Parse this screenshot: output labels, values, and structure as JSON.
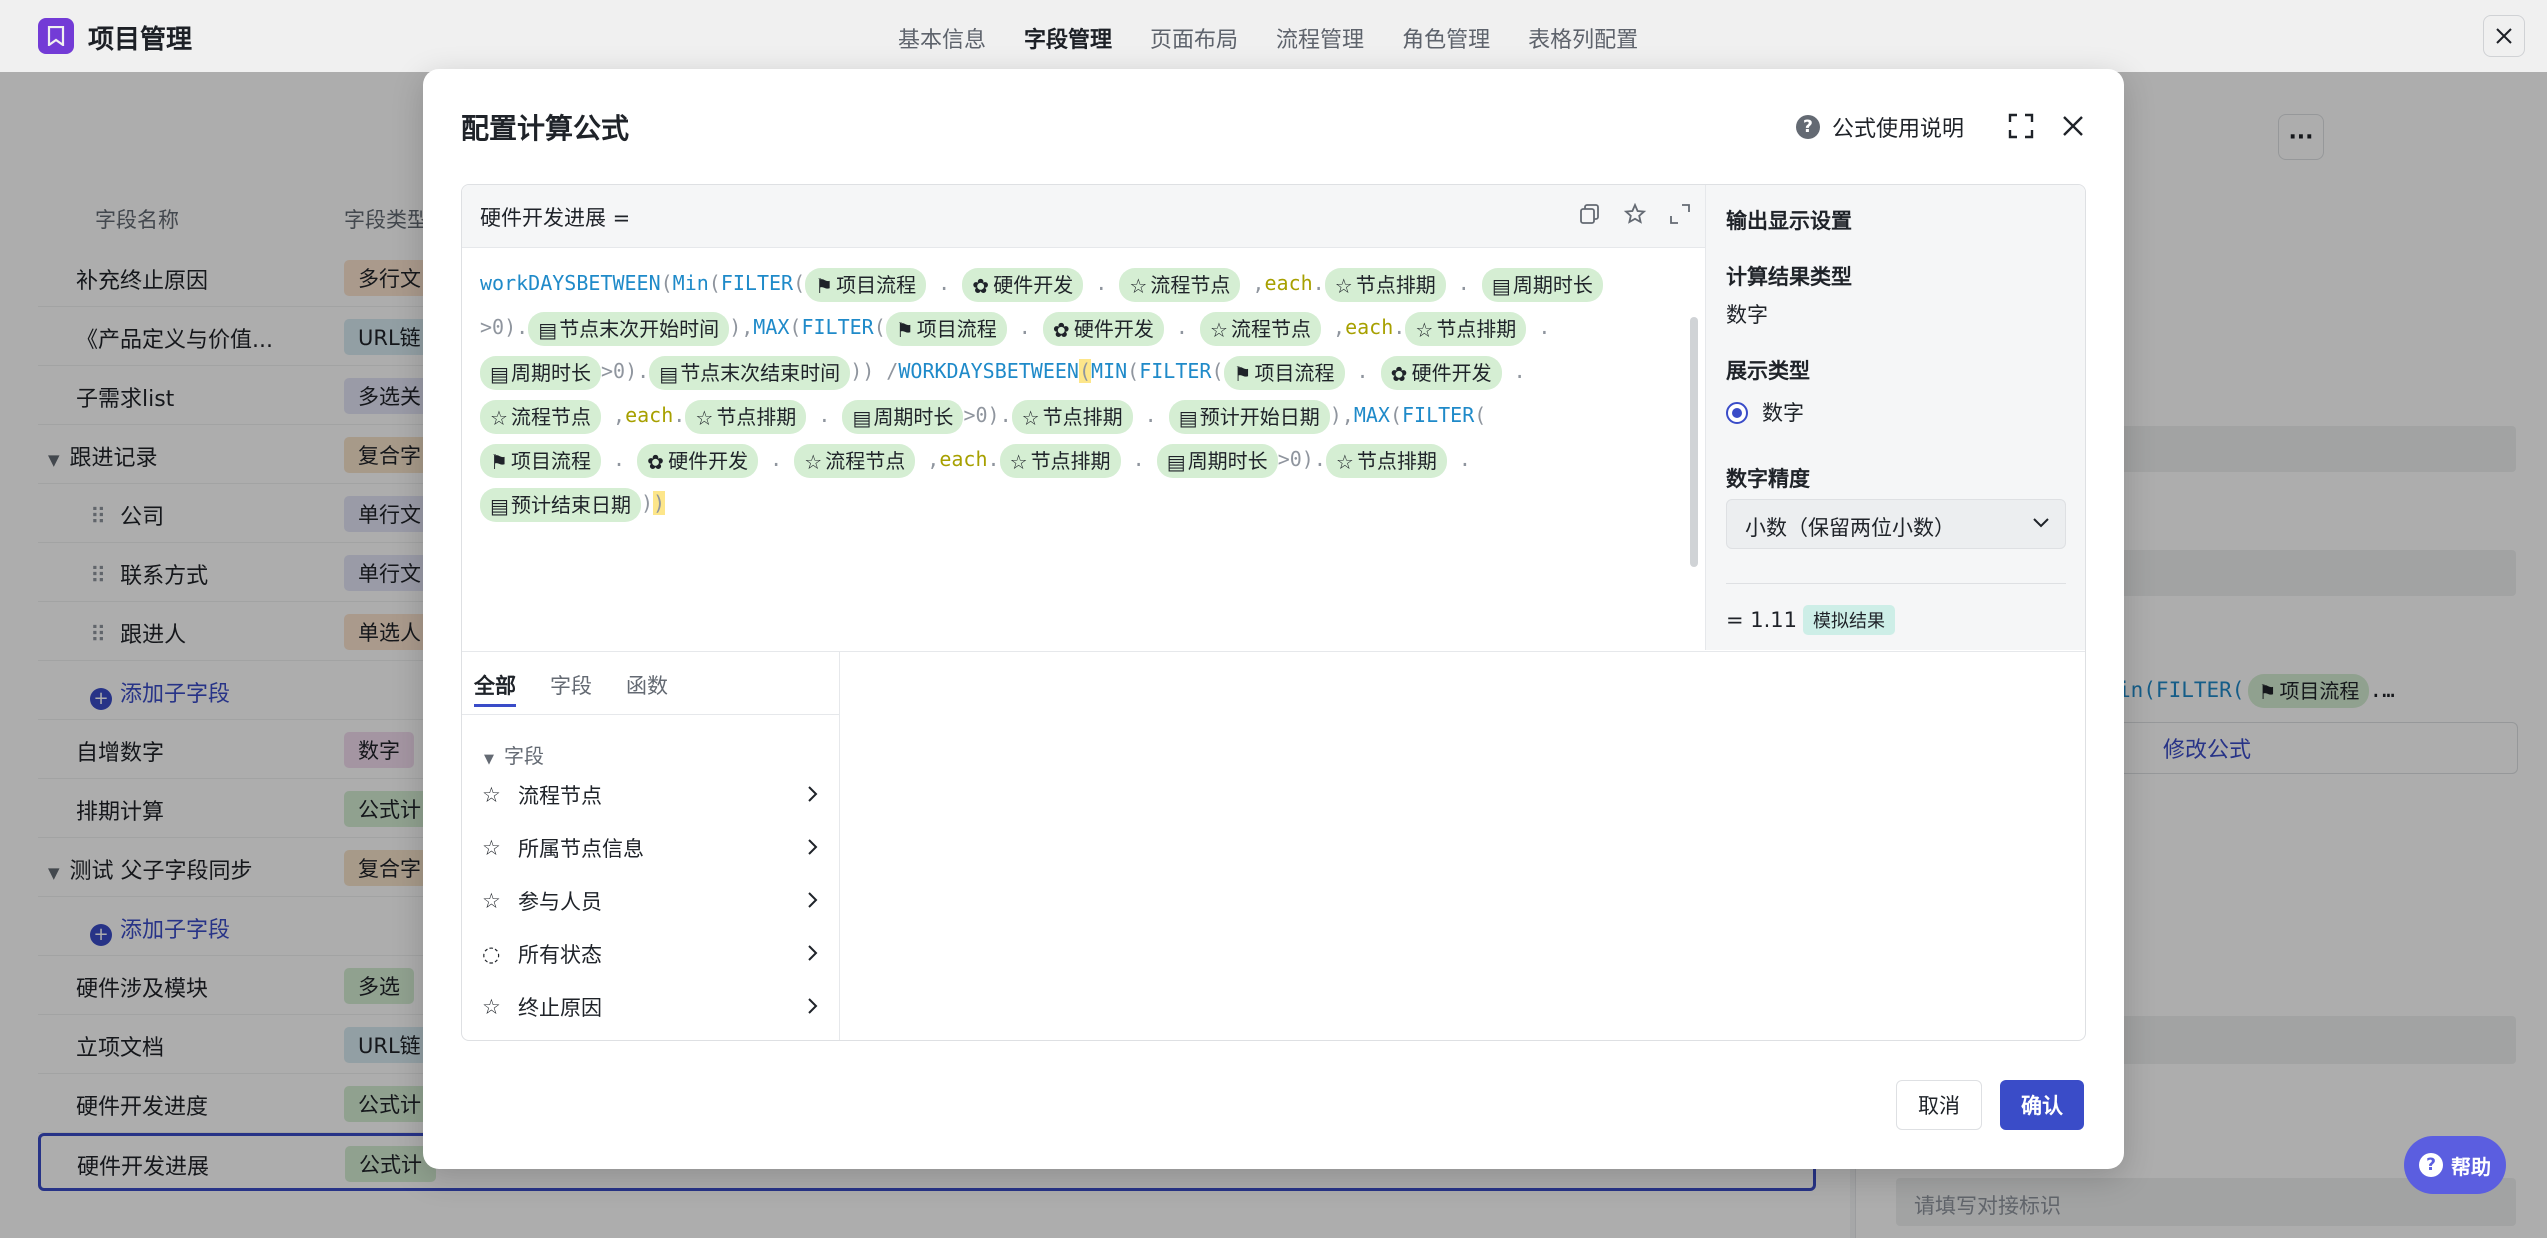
{
  "app": {
    "title": "项目管理",
    "close_icon": "close-icon"
  },
  "nav_tabs": [
    "基本信息",
    "字段管理",
    "页面布局",
    "流程管理",
    "角色管理",
    "表格列配置"
  ],
  "nav_active": "字段管理",
  "columns": {
    "name": "字段名称",
    "type": "字段类型"
  },
  "fields": [
    {
      "name": "补充终止原因",
      "type": "多行文",
      "type_color": "#fbe3cf"
    },
    {
      "name": "《产品定义与价值...",
      "type": "URL链",
      "type_color": "#d7ebf2"
    },
    {
      "name": "子需求list",
      "type": "多选关",
      "type_color": "#e3e5f7"
    },
    {
      "name": "跟进记录",
      "type": "复合字",
      "type_color": "#f7e3cb"
    },
    {
      "name": "公司",
      "type": "单行文",
      "type_color": "#e3e5f7"
    },
    {
      "name": "联系方式",
      "type": "单行文",
      "type_color": "#e3e5f7"
    },
    {
      "name": "跟进人",
      "type": "单选人",
      "type_color": "#fbe3cf"
    },
    {
      "name": "添加子字段",
      "type": "",
      "type_color": ""
    },
    {
      "name": "自增数字",
      "type": "数字",
      "type_color": "#f2dcef"
    },
    {
      "name": "排期计算",
      "type": "公式计",
      "type_color": "#d5eed3"
    },
    {
      "name": "测试 父子字段同步",
      "type": "复合字",
      "type_color": "#f7e3cb"
    },
    {
      "name": "添加子字段",
      "type": "",
      "type_color": ""
    },
    {
      "name": "硬件涉及模块",
      "type": "多选",
      "type_color": "#d5eed3"
    },
    {
      "name": "立项文档",
      "type": "URL链",
      "type_color": "#d7ebf2"
    },
    {
      "name": "硬件开发进度",
      "type": "公式计",
      "type_color": "#d5eed3"
    },
    {
      "name": "硬件开发进展",
      "type": "公式计",
      "type_color": "#d5eed3"
    }
  ],
  "right_panel": {
    "formula_preview": "in(FILTER(",
    "formula_chip": "项目流程",
    "formula_ellipsis": ".…",
    "edit_formula": "修改公式",
    "placeholder": "请填写对接标识"
  },
  "modal": {
    "title": "配置计算公式",
    "help_link": "公式使用说明",
    "editor_lhs": "硬件开发进展 =",
    "output": {
      "header": "输出显示设置",
      "result_type_label": "计算结果类型",
      "result_type_value": "数字",
      "display_type_label": "展示类型",
      "display_type_value": "数字",
      "precision_label": "数字精度",
      "precision_value": "小数（保留两位小数）",
      "sim_value": "= 1.11",
      "sim_badge": "模拟结果"
    },
    "lib_tabs": [
      "全部",
      "字段",
      "函数"
    ],
    "lib_group": "字段",
    "lib_items": [
      "流程节点",
      "所属节点信息",
      "参与人员",
      "所有状态",
      "终止原因"
    ],
    "cancel": "取消",
    "confirm": "确认"
  },
  "help_fab": "帮助"
}
